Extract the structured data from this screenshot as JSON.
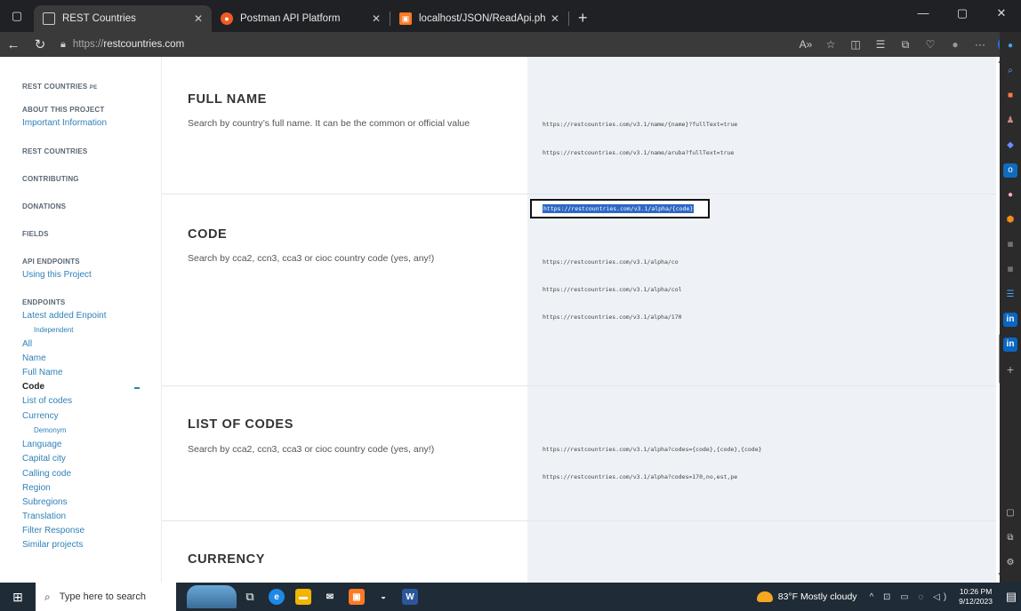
{
  "browser": {
    "tabs": [
      {
        "title": "REST Countries",
        "favicon": "page-icon",
        "active": true
      },
      {
        "title": "Postman API Platform",
        "favicon": "postman-icon",
        "active": false
      },
      {
        "title": "localhost/JSON/ReadApi.php",
        "favicon": "xampp-icon",
        "active": false
      }
    ],
    "url": "https://restcountries.com",
    "url_scheme": "https://",
    "url_host": "restcountries.com"
  },
  "sidebar": {
    "brand": "REST COUNTRIES",
    "brand_flag": "PE",
    "about_head": "ABOUT THIS PROJECT",
    "important_link": "Important Information",
    "rest_countries_head": "REST COUNTRIES",
    "contributing_head": "CONTRIBUTING",
    "donations_head": "DONATIONS",
    "fields_head": "FIELDS",
    "api_endpoints_head": "API ENDPOINTS",
    "using_link": "Using this Project",
    "endpoints_head": "ENDPOINTS",
    "endpoints": [
      {
        "label": "Latest added Enpoint",
        "sub": false
      },
      {
        "label": "Independent",
        "sub": true
      },
      {
        "label": "All",
        "sub": false
      },
      {
        "label": "Name",
        "sub": false
      },
      {
        "label": "Full Name",
        "sub": false
      },
      {
        "label": "Code",
        "sub": false,
        "current": true
      },
      {
        "label": "List of codes",
        "sub": false
      },
      {
        "label": "Currency",
        "sub": false
      },
      {
        "label": "Demonym",
        "sub": true
      },
      {
        "label": "Language",
        "sub": false
      },
      {
        "label": "Capital city",
        "sub": false
      },
      {
        "label": "Calling code",
        "sub": false
      },
      {
        "label": "Region",
        "sub": false
      },
      {
        "label": "Subregions",
        "sub": false
      },
      {
        "label": "Translation",
        "sub": false
      },
      {
        "label": "Filter Response",
        "sub": false
      },
      {
        "label": "Similar projects",
        "sub": false
      }
    ]
  },
  "sections": {
    "full_name": {
      "title": "FULL NAME",
      "desc": "Search by country’s full name. It can be the common or official value",
      "examples": [
        "https://restcountries.com/v3.1/name/{name}?fullText=true",
        "https://restcountries.com/v3.1/name/aruba?fullText=true"
      ]
    },
    "code": {
      "title": "CODE",
      "desc": "Search by cca2, ccn3, cca3 or cioc country code (yes, any!)",
      "selected_example": "https://restcountries.com/v3.1/alpha/{code}",
      "examples": [
        "https://restcountries.com/v3.1/alpha/co",
        "https://restcountries.com/v3.1/alpha/col",
        "https://restcountries.com/v3.1/alpha/170"
      ]
    },
    "list_of_codes": {
      "title": "LIST OF CODES",
      "desc": "Search by cca2, ccn3, cca3 or cioc country code (yes, any!)",
      "examples": [
        "https://restcountries.com/v3.1/alpha?codes={code},{code},{code}",
        "https://restcountries.com/v3.1/alpha?codes=170,no,est,pe"
      ]
    },
    "currency": {
      "title": "CURRENCY"
    }
  },
  "taskbar": {
    "search_placeholder": "Type here to search",
    "weather": "83°F  Mostly cloudy",
    "time": "10:26 PM",
    "date": "9/12/2023"
  },
  "colors": {
    "link": "#2f81b7",
    "code_bg": "#eef1f6",
    "selection": "#2d68c4"
  }
}
